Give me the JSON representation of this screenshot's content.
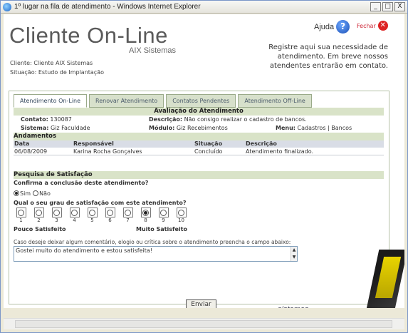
{
  "window": {
    "title": "1º lugar na fila de atendimento - Windows Internet Explorer",
    "min": "_",
    "max": "□",
    "close": "X"
  },
  "brand": {
    "title": "Cliente On-Line",
    "subtitle": "AIX Sistemas",
    "footer": "sistemas"
  },
  "client": {
    "cliente": "Cliente: Cliente AIX Sistemas",
    "situacao": "Situação: Estudo de Implantação"
  },
  "help": {
    "label": "Ajuda",
    "icon_glyph": "?"
  },
  "close": {
    "label": "Fechar",
    "icon_glyph": "✕"
  },
  "intro": [
    "Registre aqui sua necessidade de",
    "atendimento. Em breve nossos",
    "atendentes entrarão em contato."
  ],
  "tabs": [
    {
      "label": "Atendimento On-Line",
      "active": true
    },
    {
      "label": "Renovar Atendimento",
      "active": false
    },
    {
      "label": "Contatos Pendentes",
      "active": false
    },
    {
      "label": "Atendimento Off-Line",
      "active": false
    }
  ],
  "evaluation": {
    "title": "Avaliação do Atendimento",
    "contato_label": "Contato:",
    "contato": "130087",
    "descricao_label": "Descrição:",
    "descricao": "Não consigo realizar o cadastro de bancos.",
    "sistema_label": "Sistema:",
    "sistema": "Giz Faculdade",
    "modulo_label": "Módulo:",
    "modulo": "Giz Recebimentos",
    "menu_label": "Menu:",
    "menu": "Cadastros | Bancos"
  },
  "andamentos": {
    "title": "Andamentos",
    "columns": [
      "Data",
      "Responsável",
      "Situação",
      "Descrição"
    ],
    "rows": [
      [
        "06/08/2009",
        "Karina Rocha Gonçalves",
        "Concluído",
        "Atendimento finalizado."
      ]
    ]
  },
  "survey": {
    "title": "Pesquisa de Satisfação",
    "q1": "Confirma a conclusão deste atendimento?",
    "yes": "Sim",
    "no": "Não",
    "yes_selected": true,
    "q2": "Qual o seu grau de satisfação com este atendimento?",
    "scale": [
      "1",
      "2",
      "3",
      "4",
      "5",
      "6",
      "7",
      "8",
      "9",
      "10"
    ],
    "selected": "8",
    "low": "Pouco Satisfeito",
    "high": "Muito Satisfeito",
    "comment_label": "Caso deseje deixar algum comentário, elogio ou crítica sobre o atendimento preencha o campo abaixo:",
    "comment": "Gostei muito do atendimento e estou satisfeita!",
    "submit": "Enviar"
  },
  "colors": {
    "tab_bg": "#d7e0cb",
    "bar_bg": "#d9e3c8",
    "accent_yellow": "#e8d300"
  }
}
